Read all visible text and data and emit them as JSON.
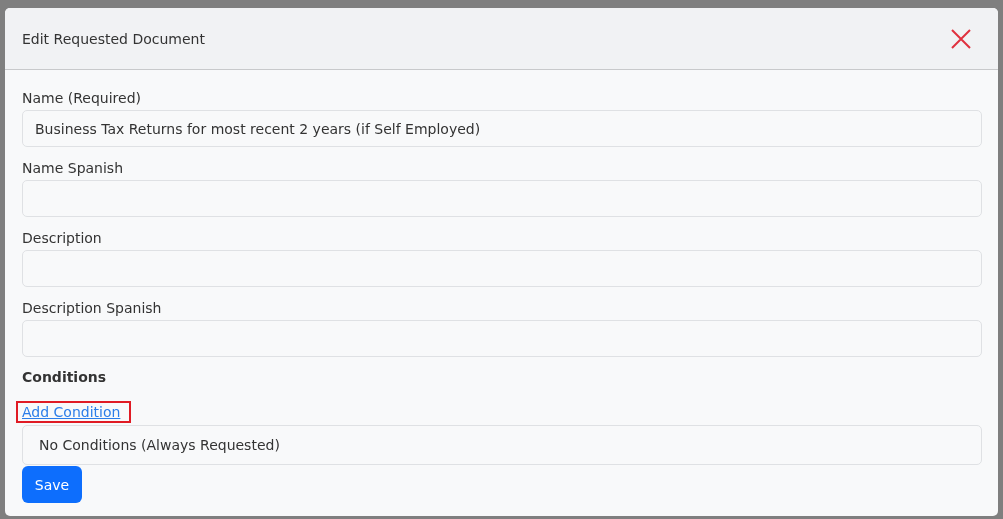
{
  "dialog": {
    "title": "Edit Requested Document",
    "fields": [
      {
        "label": "Name (Required)",
        "value": "Business Tax Returns for most recent 2 years (if Self Employed)"
      },
      {
        "label": "Name Spanish"
      },
      {
        "label": "Description"
      },
      {
        "label": "Description Spanish"
      }
    ],
    "conditions": {
      "heading": "Conditions",
      "add_link": "Add Condition",
      "highlighted": true,
      "empty_text": "No Conditions (Always Requested)"
    },
    "save_button": "Save"
  }
}
